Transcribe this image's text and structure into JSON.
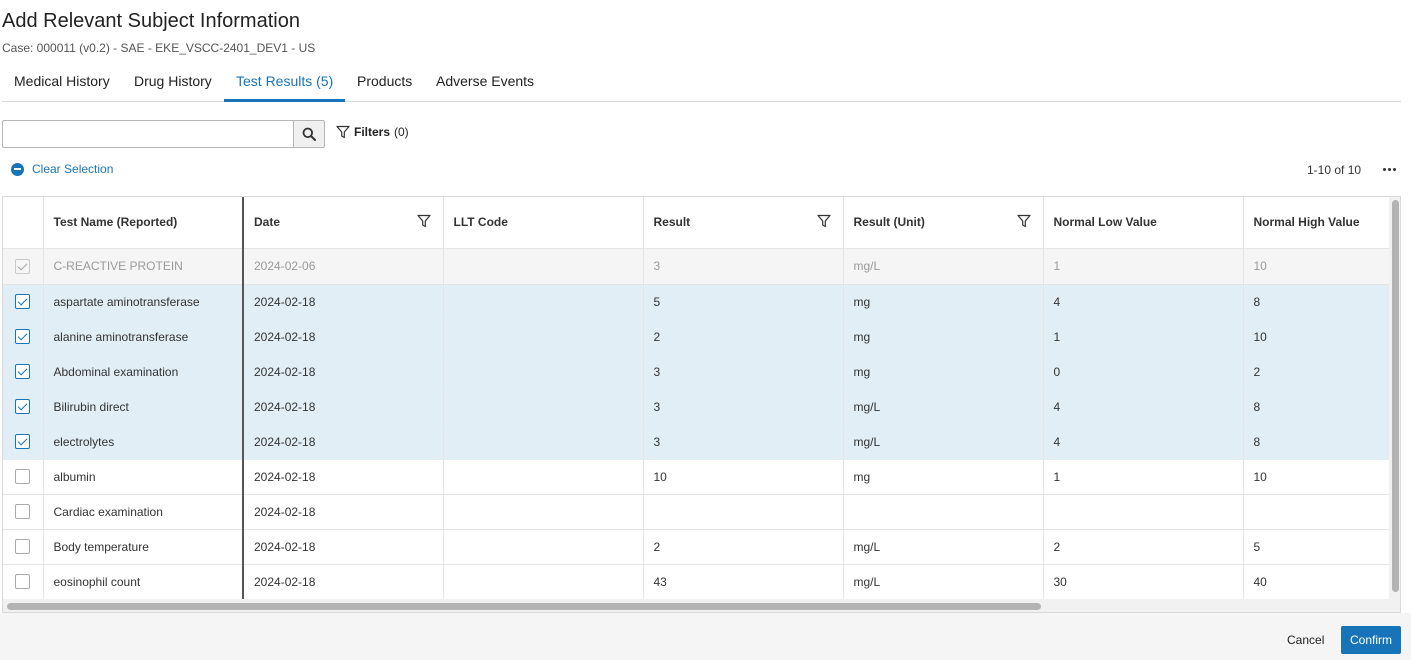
{
  "header": {
    "title": "Add Relevant Subject Information",
    "subtitle": "Case: 000011 (v0.2) - SAE - EKE_VSCC-2401_DEV1 - US"
  },
  "tabs": [
    {
      "label": "Medical History"
    },
    {
      "label": "Drug History"
    },
    {
      "label": "Test Results (5)"
    },
    {
      "label": "Products"
    },
    {
      "label": "Adverse Events"
    }
  ],
  "toolbar": {
    "search_value": "",
    "filters_label": "Filters",
    "filters_count": "(0)",
    "clear_selection": "Clear Selection",
    "count": "1-10 of 10"
  },
  "table": {
    "columns": [
      "Test Name (Reported)",
      "Date",
      "LLT Code",
      "Result",
      "Result (Unit)",
      "Normal Low Value",
      "Normal High Value"
    ],
    "rows": [
      {
        "name": "C-REACTIVE PROTEIN",
        "date": "2024-02-06",
        "llt": "",
        "result": "3",
        "unit": "mg/L",
        "low": "1",
        "high": "10"
      },
      {
        "name": "aspartate aminotransferase",
        "date": "2024-02-18",
        "llt": "",
        "result": "5",
        "unit": "mg",
        "low": "4",
        "high": "8"
      },
      {
        "name": "alanine aminotransferase",
        "date": "2024-02-18",
        "llt": "",
        "result": "2",
        "unit": "mg",
        "low": "1",
        "high": "10"
      },
      {
        "name": "Abdominal examination",
        "date": "2024-02-18",
        "llt": "",
        "result": "3",
        "unit": "mg",
        "low": "0",
        "high": "2"
      },
      {
        "name": "Bilirubin direct",
        "date": "2024-02-18",
        "llt": "",
        "result": "3",
        "unit": "mg/L",
        "low": "4",
        "high": "8"
      },
      {
        "name": "electrolytes",
        "date": "2024-02-18",
        "llt": "",
        "result": "3",
        "unit": "mg/L",
        "low": "4",
        "high": "8"
      },
      {
        "name": "albumin",
        "date": "2024-02-18",
        "llt": "",
        "result": "10",
        "unit": "mg",
        "low": "1",
        "high": "10"
      },
      {
        "name": "Cardiac examination",
        "date": "2024-02-18",
        "llt": "",
        "result": "",
        "unit": "",
        "low": "",
        "high": ""
      },
      {
        "name": "Body temperature",
        "date": "2024-02-18",
        "llt": "",
        "result": "2",
        "unit": "mg/L",
        "low": "2",
        "high": "5"
      },
      {
        "name": "eosinophil count",
        "date": "2024-02-18",
        "llt": "",
        "result": "43",
        "unit": "mg/L",
        "low": "30",
        "high": "40"
      }
    ]
  },
  "footer": {
    "cancel_label": "Cancel",
    "confirm_label": "Confirm"
  },
  "colors": {
    "accent": "#1874b8",
    "selected_row": "#e1eef6",
    "disabled_row": "#f5f5f5"
  },
  "icons": [
    "search-icon",
    "filter-icon",
    "minus-circle-icon",
    "more-horizontal-icon",
    "checkbox-checked-icon"
  ]
}
